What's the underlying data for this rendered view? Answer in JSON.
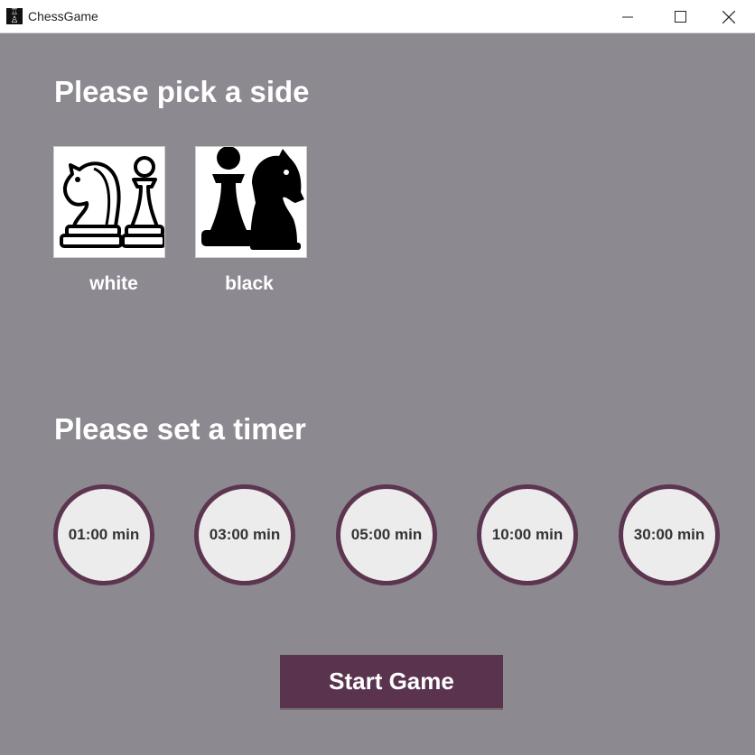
{
  "window": {
    "title": "ChessGame",
    "icon": "chess-app-icon",
    "controls": [
      "minimize-icon",
      "maximize-icon",
      "close-icon"
    ]
  },
  "sides": {
    "heading": "Please pick a side",
    "options": [
      {
        "label": "white",
        "icon": "white-knight-pawn-icon"
      },
      {
        "label": "black",
        "icon": "black-pawn-knight-icon"
      }
    ]
  },
  "timer": {
    "heading": "Please set a timer",
    "options": [
      "01:00 min",
      "03:00 min",
      "05:00 min",
      "10:00 min",
      "30:00 min"
    ]
  },
  "start_button": {
    "label": "Start Game"
  },
  "colors": {
    "background": "#8c8990",
    "accent": "#5a344e",
    "timer_fill": "#ececec"
  }
}
